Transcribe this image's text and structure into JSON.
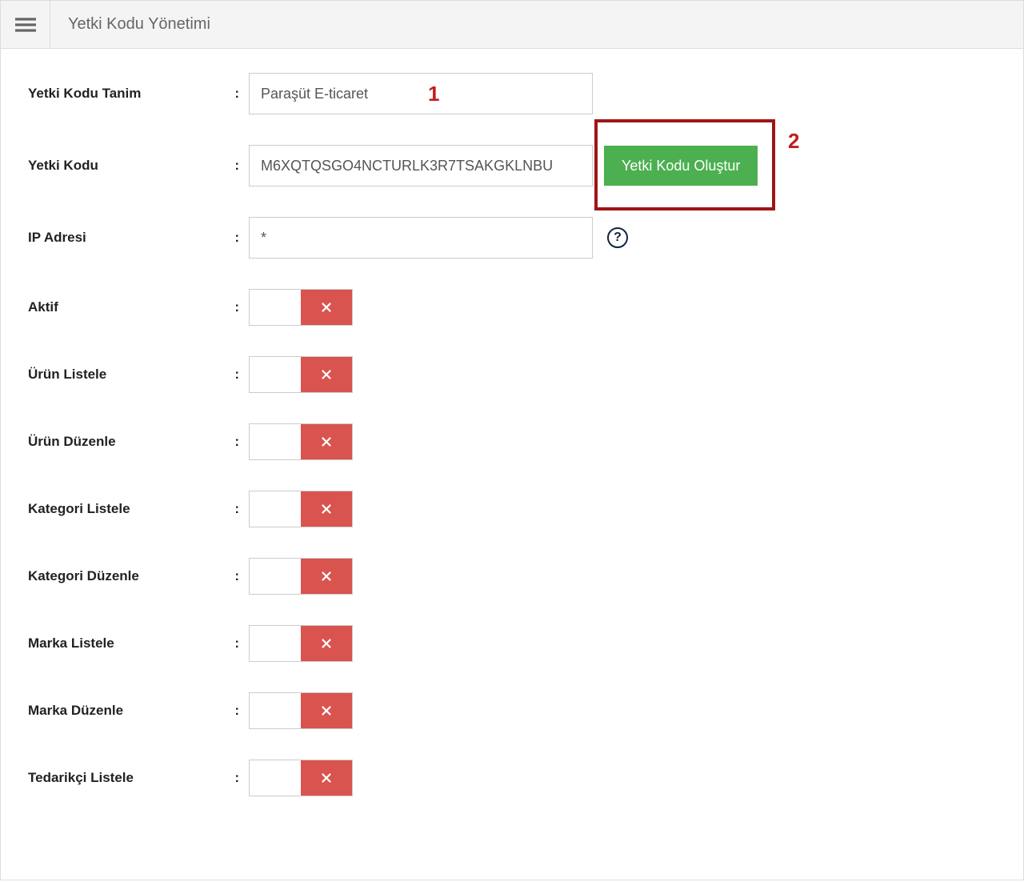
{
  "header": {
    "title": "Yetki Kodu Yönetimi"
  },
  "form": {
    "tanim_label": "Yetki Kodu Tanim",
    "tanim_value": "Paraşüt E-ticaret",
    "kod_label": "Yetki Kodu",
    "kod_value": "M6XQTQSGO4NCTURLK3R7TSAKGKLNBU",
    "generate_label": "Yetki Kodu Oluştur",
    "ip_label": "IP Adresi",
    "ip_value": "*"
  },
  "annotations": {
    "one": "1",
    "two": "2"
  },
  "toggles": [
    {
      "label": "Aktif"
    },
    {
      "label": "Ürün Listele"
    },
    {
      "label": "Ürün Düzenle"
    },
    {
      "label": "Kategori Listele"
    },
    {
      "label": "Kategori Düzenle"
    },
    {
      "label": "Marka Listele"
    },
    {
      "label": "Marka Düzenle"
    },
    {
      "label": "Tedarikçi Listele"
    }
  ]
}
